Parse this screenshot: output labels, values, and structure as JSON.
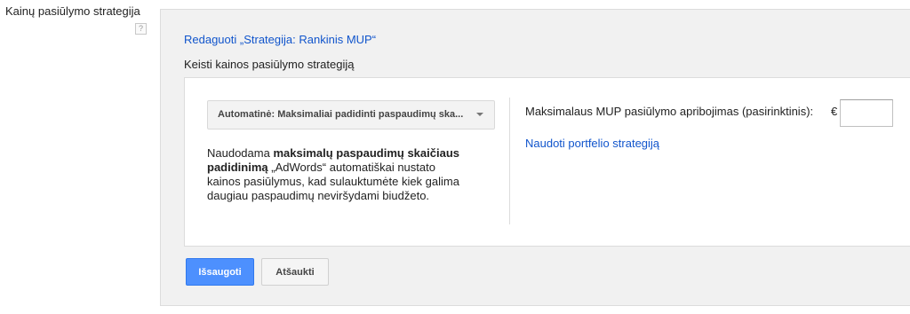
{
  "field": {
    "label": "Kainų pasiūlymo strategija",
    "help_icon_text": "?"
  },
  "editor": {
    "edit_link": "Redaguoti „Strategija: Rankinis MUP“",
    "change_label": "Keisti kainos pasiūlymo strategiją",
    "strategy_dropdown": {
      "selected": "Automatinė: Maksimaliai padidinti paspaudimų ska..."
    },
    "description": {
      "prefix": "Naudodama ",
      "bold": "maksimalų paspaudimų skaičiaus padidinimą",
      "suffix": " „AdWords“ automatiškai nustato kainos pasiūlymus, kad sulauktumėte kiek galima daugiau paspaudimų neviršydami biudžeto."
    },
    "max_cpc": {
      "label": "Maksimalaus MUP pasiūlymo apribojimas (pasirinktinis):",
      "currency": "€",
      "value": ""
    },
    "portfolio_link": "Naudoti portfelio strategiją"
  },
  "actions": {
    "save_label": "Išsaugoti",
    "cancel_label": "Atšaukti"
  },
  "colors": {
    "link": "#1155cc",
    "primary_button": "#4d90fe",
    "panel_background": "#f1f1f1"
  }
}
